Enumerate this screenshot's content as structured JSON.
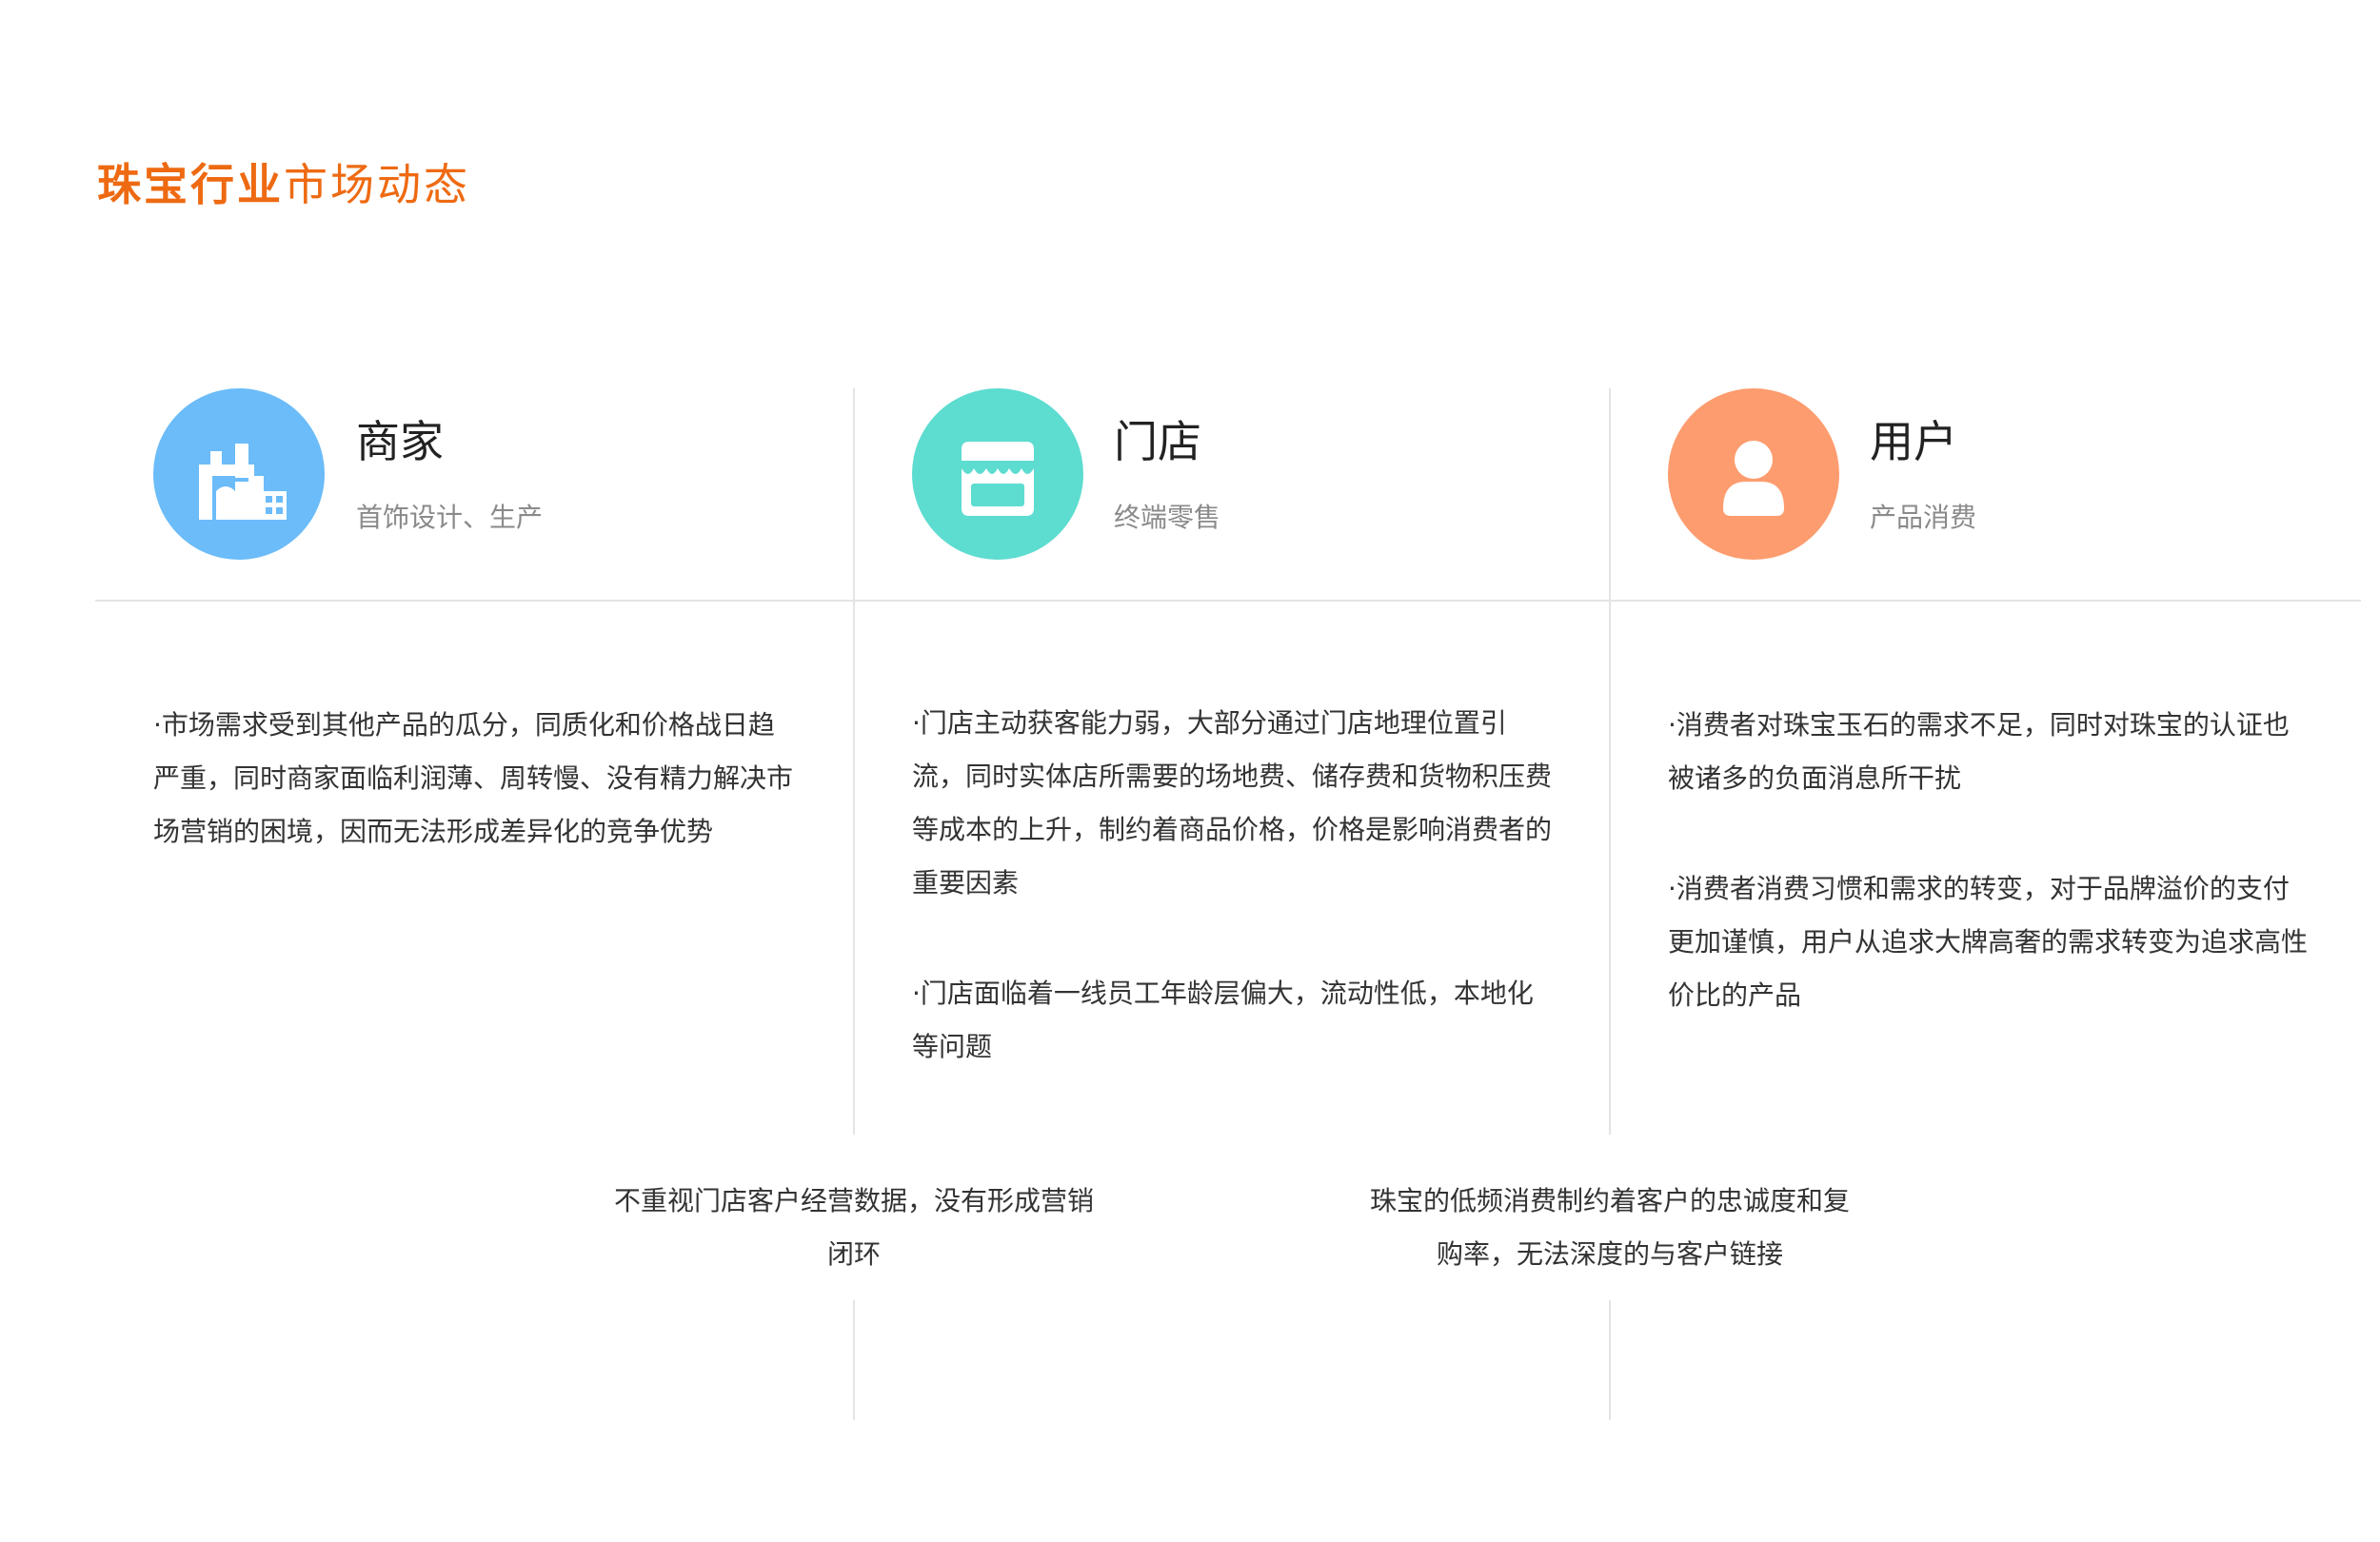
{
  "header": {
    "title_bold": "珠宝行业",
    "title_rest": "市场动态"
  },
  "columns": [
    {
      "icon": "factory-icon",
      "color": "#6bbcf9",
      "title": "商家",
      "subtitle": "首饰设计、生产",
      "paragraphs": [
        "·市场需求受到其他产品的瓜分，同质化和价格战日趋严重，同时商家面临利润薄、周转慢、没有精力解决市场营销的困境，因而无法形成差异化的竞争优势"
      ]
    },
    {
      "icon": "store-icon",
      "color": "#5ddcd0",
      "title": "门店",
      "subtitle": "终端零售",
      "paragraphs": [
        "·门店主动获客能力弱，大部分通过门店地理位置引流，同时实体店所需要的场地费、储存费和货物积压费等成本的上升，制约着商品价格，价格是影响消费者的重要因素",
        "·门店面临着一线员工年龄层偏大，流动性低，本地化等问题"
      ]
    },
    {
      "icon": "user-icon",
      "color": "#fd9c6e",
      "title": "用户",
      "subtitle": "产品消费",
      "paragraphs": [
        "·消费者对珠宝玉石的需求不足，同时对珠宝的认证也被诸多的负面消息所干扰",
        "·消费者消费习惯和需求的转变，对于品牌溢价的支付更加谨慎，用户从追求大牌高奢的需求转变为追求高性价比的产品"
      ]
    }
  ],
  "bottom_notes": [
    "不重视门店客户经营数据，没有形成营销闭环",
    "珠宝的低频消费制约着客户的忠诚度和复购率，无法深度的与客户链接"
  ]
}
